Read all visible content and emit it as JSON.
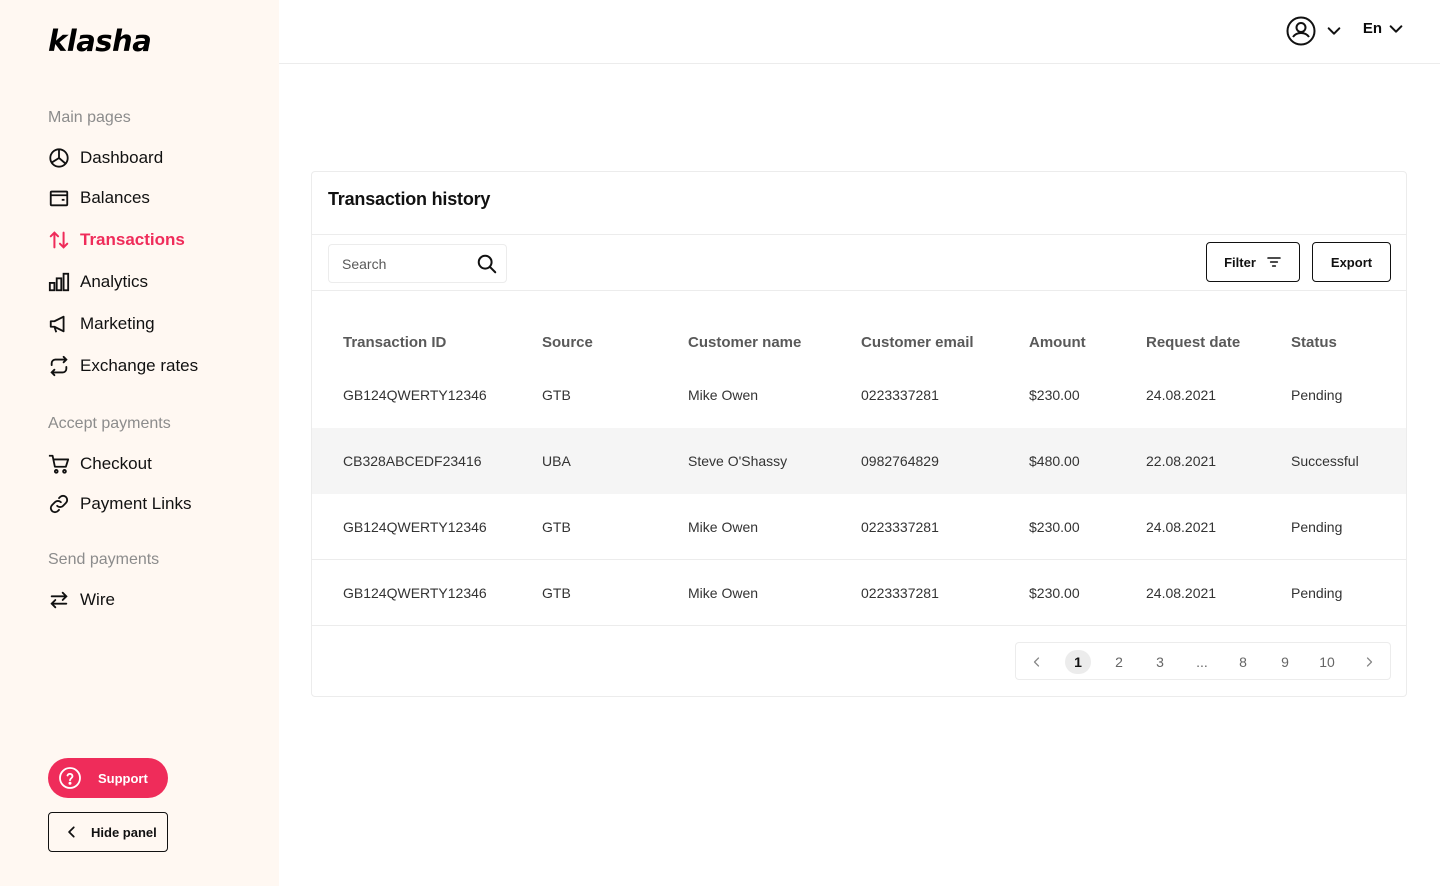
{
  "brand": {
    "logo_text": "klasha",
    "accent_color": "#ef2c5a"
  },
  "sidebar": {
    "sections": [
      {
        "label": "Main pages"
      },
      {
        "label": "Accept payments"
      },
      {
        "label": "Send payments"
      }
    ],
    "items": [
      {
        "label": "Dashboard",
        "icon": "pie-chart-icon",
        "active": false
      },
      {
        "label": "Balances",
        "icon": "wallet-icon",
        "active": false
      },
      {
        "label": "Transactions",
        "icon": "transfer-arrows-icon",
        "active": true
      },
      {
        "label": "Analytics",
        "icon": "bar-chart-icon",
        "active": false
      },
      {
        "label": "Marketing",
        "icon": "megaphone-icon",
        "active": false
      },
      {
        "label": "Exchange rates",
        "icon": "refresh-icon",
        "active": false
      },
      {
        "label": "Checkout",
        "icon": "cart-icon",
        "active": false
      },
      {
        "label": "Payment Links",
        "icon": "link-icon",
        "active": false
      },
      {
        "label": "Wire",
        "icon": "swap-arrows-icon",
        "active": false
      }
    ],
    "support_label": "Support",
    "hide_panel_label": "Hide panel"
  },
  "header": {
    "user_icon": "user-circle-icon",
    "language": "En"
  },
  "transactions": {
    "title": "Transaction history",
    "search_placeholder": "Search",
    "filter_label": "Filter",
    "export_label": "Export",
    "columns": [
      "Transaction ID",
      "Source",
      "Customer name",
      "Customer email",
      "Amount",
      "Request date",
      "Status"
    ],
    "rows": [
      [
        "GB124QWERTY12346",
        "GTB",
        "Mike Owen",
        "0223337281",
        "$230.00",
        "24.08.2021",
        "Pending"
      ],
      [
        "CB328ABCEDF23416",
        "UBA",
        "Steve O'Shassy",
        "0982764829",
        "$480.00",
        "22.08.2021",
        "Successful"
      ],
      [
        "GB124QWERTY12346",
        "GTB",
        "Mike Owen",
        "0223337281",
        "$230.00",
        "24.08.2021",
        "Pending"
      ],
      [
        "GB124QWERTY12346",
        "GTB",
        "Mike Owen",
        "0223337281",
        "$230.00",
        "24.08.2021",
        "Pending"
      ]
    ],
    "pagination": {
      "pages": [
        "1",
        "2",
        "3",
        "...",
        "8",
        "9",
        "10"
      ],
      "current": "1"
    }
  }
}
